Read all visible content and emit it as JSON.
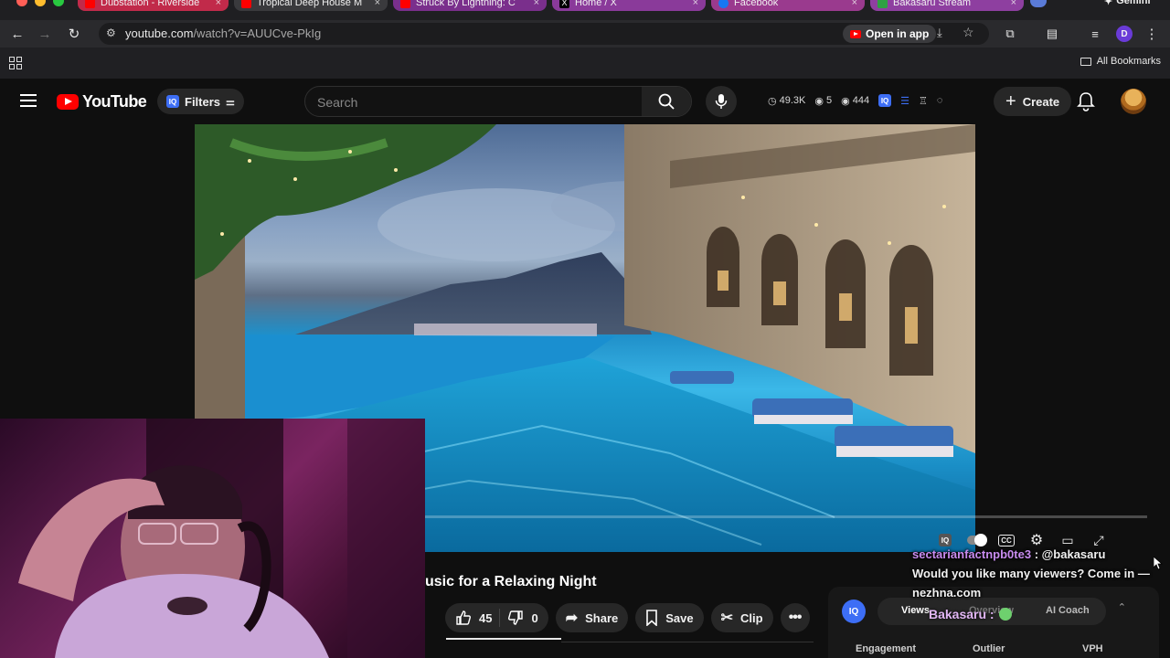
{
  "browser": {
    "tabs": [
      {
        "title": "Dubstation - Riverside",
        "favicon_color": "#ff0000",
        "active": false
      },
      {
        "title": "Tropical Deep House M",
        "favicon_color": "#ff0000",
        "active": true
      },
      {
        "title": "Struck By Lightning: C",
        "favicon_color": "#ff0000",
        "active": false
      },
      {
        "title": "Home / X",
        "favicon_color": "#000000",
        "active": false
      },
      {
        "title": "Facebook",
        "favicon_color": "#1877f2",
        "active": false
      },
      {
        "title": "Bakasaru Stream",
        "favicon_color": "#2ea043",
        "active": false
      }
    ],
    "gemini_label": "Gemini",
    "url_host": "youtube.com",
    "url_path": "/watch?v=AUUCve-PkIg",
    "open_in_app": "Open in app",
    "profile_initial": "D",
    "all_bookmarks": "All Bookmarks"
  },
  "masthead": {
    "logo_text": "YouTube",
    "iq_badge": "IQ",
    "filters_label": "Filters",
    "search_placeholder": "Search",
    "stats": {
      "views": "49.3K",
      "watching": "5",
      "eye_count": "444"
    },
    "create_label": "Create"
  },
  "video": {
    "title": "usic for a Relaxing Night",
    "like_count": "45",
    "dislike_count": "0",
    "share_label": "Share",
    "save_label": "Save",
    "clip_label": "Clip"
  },
  "chat": {
    "username": "sectarianfactnpb0te3",
    "mention": ": @bakasaru",
    "message": "Would you like many viewers? Come in — nezhna.com"
  },
  "iq_panel": {
    "tabs": [
      "Views",
      "Overview",
      "AI Coach"
    ],
    "overlay_name": "Bakasaru :",
    "metrics": [
      "Engagement",
      "Outlier",
      "VPH"
    ]
  }
}
